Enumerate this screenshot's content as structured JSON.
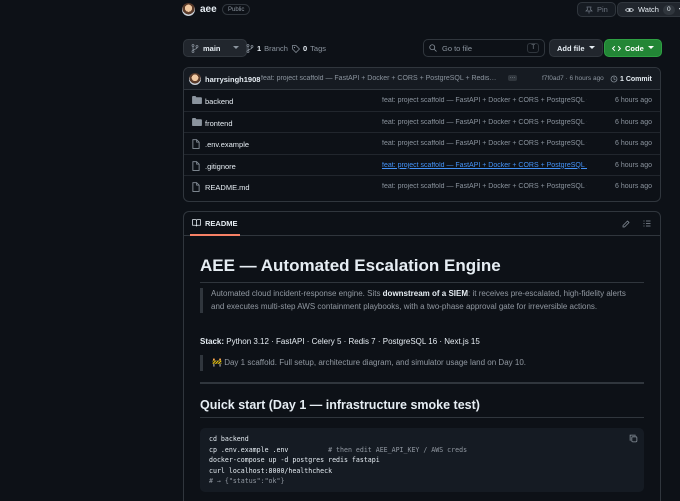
{
  "repo": {
    "name": "aee",
    "visibility": "Public",
    "pin_label": "Pin",
    "watch_label": "Watch",
    "watch_count": "0"
  },
  "branch_bar": {
    "branch": "main",
    "branches_count": "1",
    "branches_label": "Branch",
    "tags_count": "0",
    "tags_label": "Tags",
    "search_placeholder": "Go to file",
    "search_shortcut": "T",
    "add_file_label": "Add file",
    "code_label": "Code"
  },
  "latest_commit": {
    "author": "harrysingh1908",
    "message": "feat: project scaffold — FastAPI + Docker + CORS + PostgreSQL + Redis…",
    "meta": "f7f0ad7 · 6 hours ago",
    "count": "1 Commit"
  },
  "files": [
    {
      "name": "backend",
      "type": "folder",
      "commit": "feat: project scaffold — FastAPI + Docker + CORS + PostgreSQL + Redis",
      "age": "6 hours ago"
    },
    {
      "name": "frontend",
      "type": "folder",
      "commit": "feat: project scaffold — FastAPI + Docker + CORS + PostgreSQL + Redis",
      "age": "6 hours ago"
    },
    {
      "name": ".env.example",
      "type": "file",
      "commit": "feat: project scaffold — FastAPI + Docker + CORS + PostgreSQL + Redis",
      "age": "6 hours ago"
    },
    {
      "name": ".gitignore",
      "type": "file",
      "commit": "feat: project scaffold — FastAPI + Docker + CORS + PostgreSQL + Redis",
      "age": "6 hours ago"
    },
    {
      "name": "README.md",
      "type": "file",
      "commit": "feat: project scaffold — FastAPI + Docker + CORS + PostgreSQL + Redis",
      "age": "6 hours ago"
    }
  ],
  "readme": {
    "tab_label": "README",
    "title": "AEE — Automated Escalation Engine",
    "quote_before": "Automated cloud incident-response engine. Sits ",
    "quote_bold": "downstream of a SIEM",
    "quote_after": ": it receives pre-escalated, high-fidelity alerts and executes multi-step AWS containment playbooks, with a two-phase approval gate for irreversible actions.",
    "stack_label": "Stack:",
    "stack_value": " Python 3.12 · FastAPI · Celery 5 · Redis 7 · PostgreSQL 16 · Next.js 15",
    "note_emoji": "🚧",
    "note_text": "Day 1 scaffold. Full setup, architecture diagram, and simulator usage land on Day 10.",
    "quickstart_heading": "Quick start (Day 1 — infrastructure smoke test)",
    "code_lines": [
      {
        "code": "cd backend",
        "comment": ""
      },
      {
        "code": "cp .env.example .env          ",
        "comment": "# then edit AEE_API_KEY / AWS creds"
      },
      {
        "code": "docker-compose up -d postgres redis fastapi",
        "comment": ""
      },
      {
        "code": "curl localhost:8000/healthcheck",
        "comment": ""
      },
      {
        "code": "",
        "comment": "# → {\"status\":\"ok\"}"
      }
    ]
  }
}
